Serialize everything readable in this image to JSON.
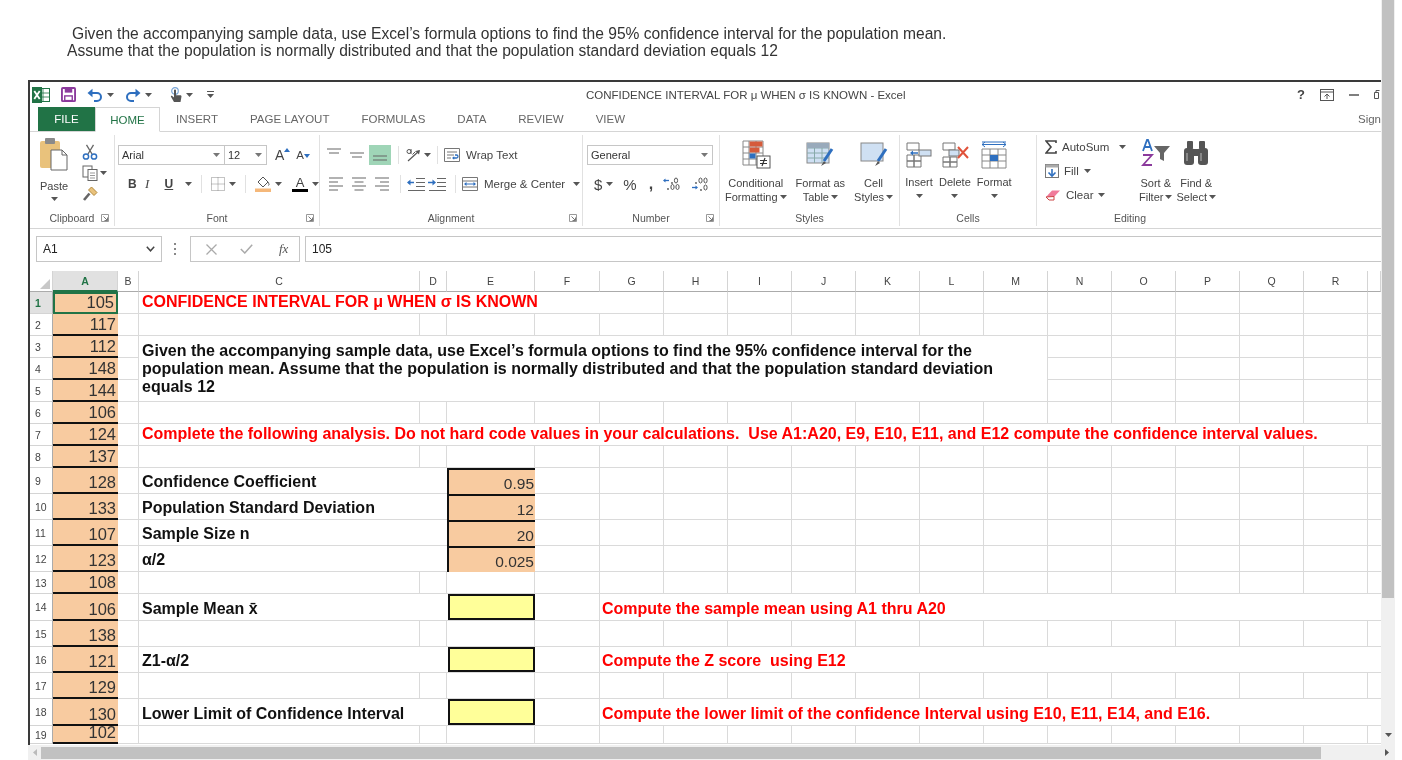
{
  "question": [
    "Given the accompanying sample data, use Excel’s formula options to find the 95% confidence interval for the population mean.",
    "Assume that the population is normally distributed and that the population standard deviation equals 12"
  ],
  "window": {
    "title": "CONFIDENCE INTERVAL FOR μ WHEN σ IS KNOWN - Excel",
    "help": "?"
  },
  "tabs": [
    {
      "label": "FILE",
      "kind": "file",
      "selected": false
    },
    {
      "label": "HOME",
      "kind": "tab",
      "selected": true
    },
    {
      "label": "INSERT",
      "kind": "tab",
      "selected": false
    },
    {
      "label": "PAGE LAYOUT",
      "kind": "tab",
      "selected": false
    },
    {
      "label": "FORMULAS",
      "kind": "tab",
      "selected": false
    },
    {
      "label": "DATA",
      "kind": "tab",
      "selected": false
    },
    {
      "label": "REVIEW",
      "kind": "tab",
      "selected": false
    },
    {
      "label": "VIEW",
      "kind": "tab",
      "selected": false
    }
  ],
  "account": "Sign",
  "ribbon": {
    "clipboard": {
      "paste": "Paste",
      "label": "Clipboard"
    },
    "font": {
      "name": "Arial",
      "size": "12",
      "grow": "A",
      "shrink": "A",
      "bold": "B",
      "italic": "I",
      "underline": "U",
      "tint": "A",
      "label": "Font"
    },
    "alignment": {
      "vertical": [
        {
          "kind": "top",
          "selected": false
        },
        {
          "kind": "middle",
          "selected": false
        },
        {
          "kind": "bottom",
          "selected": true
        }
      ],
      "horizontal": [
        {
          "kind": "left",
          "selected": false
        },
        {
          "kind": "center",
          "selected": false
        },
        {
          "kind": "right",
          "selected": false
        }
      ],
      "wrap": "Wrap Text",
      "merge": "Merge & Center",
      "label": "Alignment"
    },
    "number": {
      "format": "General",
      "currency": "$",
      "percent": "%",
      "comma": ",",
      "label": "Number"
    },
    "styles": {
      "buttons": [
        {
          "kind": "conditional",
          "lines": [
            "Conditional",
            "Formatting"
          ]
        },
        {
          "kind": "table",
          "lines": [
            "Format as",
            "Table"
          ]
        },
        {
          "kind": "cell",
          "lines": [
            "Cell",
            "Styles"
          ]
        }
      ],
      "label": "Styles"
    },
    "cells": {
      "buttons": [
        {
          "kind": "insert",
          "label": "Insert"
        },
        {
          "kind": "delete",
          "label": "Delete"
        },
        {
          "kind": "format",
          "label": "Format"
        }
      ],
      "label": "Cells"
    },
    "editing": {
      "autosum": "AutoSum",
      "fill": "Fill",
      "clear": "Clear",
      "sort": [
        "Sort &",
        "Filter"
      ],
      "find": [
        "Find &",
        "Select"
      ],
      "label": "Editing"
    }
  },
  "formula_bar": {
    "name_box": "A1",
    "function_label": "fx",
    "value": "105"
  },
  "sheet": {
    "columns": [
      {
        "label": "A",
        "selected": true
      },
      {
        "label": "B",
        "selected": false
      },
      {
        "label": "C",
        "selected": false
      },
      {
        "label": "D",
        "selected": false
      },
      {
        "label": "E",
        "selected": false
      },
      {
        "label": "F",
        "selected": false
      },
      {
        "label": "G",
        "selected": false
      },
      {
        "label": "H",
        "selected": false
      },
      {
        "label": "I",
        "selected": false
      },
      {
        "label": "J",
        "selected": false
      },
      {
        "label": "K",
        "selected": false
      },
      {
        "label": "L",
        "selected": false
      },
      {
        "label": "M",
        "selected": false
      },
      {
        "label": "N",
        "selected": false
      },
      {
        "label": "O",
        "selected": false
      },
      {
        "label": "P",
        "selected": false
      },
      {
        "label": "Q",
        "selected": false
      },
      {
        "label": "R",
        "selected": false
      }
    ],
    "rows": [
      {
        "number": "1",
        "selected": true,
        "col_a": {
          "text": "105",
          "selected": true
        },
        "col_c": {
          "kind": "title",
          "text": "CONFIDENCE INTERVAL FOR μ WHEN σ IS KNOWN"
        }
      },
      {
        "number": "2",
        "selected": false,
        "col_a": {
          "text": "117",
          "selected": false
        }
      },
      {
        "number": "3",
        "selected": false,
        "col_a": {
          "text": "112",
          "selected": false
        },
        "col_c": {
          "kind": "paragraph",
          "text": "Given the accompanying sample data, use Excel’s formula options to find the 95% confidence interval for the population mean. Assume that the population is normally distributed and that the population standard deviation equals 12"
        }
      },
      {
        "number": "4",
        "selected": false,
        "col_a": {
          "text": "148",
          "selected": false
        }
      },
      {
        "number": "5",
        "selected": false,
        "col_a": {
          "text": "144",
          "selected": false
        }
      },
      {
        "number": "6",
        "selected": false,
        "col_a": {
          "text": "106",
          "selected": false
        }
      },
      {
        "number": "7",
        "selected": false,
        "col_a": {
          "text": "124",
          "selected": false
        },
        "col_c": {
          "kind": "note",
          "text": "Complete the following analysis. Do not hard code values in your calculations.  Use A1:A20, E9, E10, E11, and E12 compute the confidence interval values."
        }
      },
      {
        "number": "8",
        "selected": false,
        "col_a": {
          "text": "137",
          "selected": false
        }
      },
      {
        "number": "9",
        "selected": false,
        "col_a": {
          "text": "128",
          "selected": false
        },
        "col_c": {
          "kind": "label",
          "text": "Confidence Coefficient"
        },
        "col_e": {
          "kind": "value",
          "text": "0.95"
        }
      },
      {
        "number": "10",
        "selected": false,
        "col_a": {
          "text": "133",
          "selected": false
        },
        "col_c": {
          "kind": "label",
          "text": "Population Standard Deviation"
        },
        "col_e": {
          "kind": "value",
          "text": "12"
        }
      },
      {
        "number": "11",
        "selected": false,
        "col_a": {
          "text": "107",
          "selected": false
        },
        "col_c": {
          "kind": "label",
          "text": "Sample Size n"
        },
        "col_e": {
          "kind": "value",
          "text": "20"
        }
      },
      {
        "number": "12",
        "selected": false,
        "col_a": {
          "text": "123",
          "selected": false
        },
        "col_c": {
          "kind": "label",
          "text": "α/2"
        },
        "col_e": {
          "kind": "value",
          "text": "0.025"
        }
      },
      {
        "number": "13",
        "selected": false,
        "col_a": {
          "text": "108",
          "selected": false
        }
      },
      {
        "number": "14",
        "selected": false,
        "col_a": {
          "text": "106",
          "selected": false
        },
        "col_c": {
          "kind": "label",
          "text": "Sample Mean x̄"
        },
        "col_e": {
          "kind": "answer"
        },
        "col_g": {
          "kind": "note",
          "text": "Compute the sample mean using A1 thru A20"
        }
      },
      {
        "number": "15",
        "selected": false,
        "col_a": {
          "text": "138",
          "selected": false
        }
      },
      {
        "number": "16",
        "selected": false,
        "col_a": {
          "text": "121",
          "selected": false
        },
        "col_c": {
          "kind": "label",
          "text": "Z1-α/2"
        },
        "col_e": {
          "kind": "answer"
        },
        "col_g": {
          "kind": "note",
          "text": "Compute the Z score  using E12"
        }
      },
      {
        "number": "17",
        "selected": false,
        "col_a": {
          "text": "129",
          "selected": false
        }
      },
      {
        "number": "18",
        "selected": false,
        "col_a": {
          "text": "130",
          "selected": false
        },
        "col_c": {
          "kind": "label",
          "text": "Lower Limit of Confidence Interval"
        },
        "col_e": {
          "kind": "answer"
        },
        "col_g": {
          "kind": "note",
          "text": "Compute the lower limit of the confidence Interval using E10, E11, E14, and E16."
        }
      },
      {
        "number": "19",
        "selected": false,
        "col_a": {
          "text": "102",
          "selected": false
        }
      }
    ]
  }
}
